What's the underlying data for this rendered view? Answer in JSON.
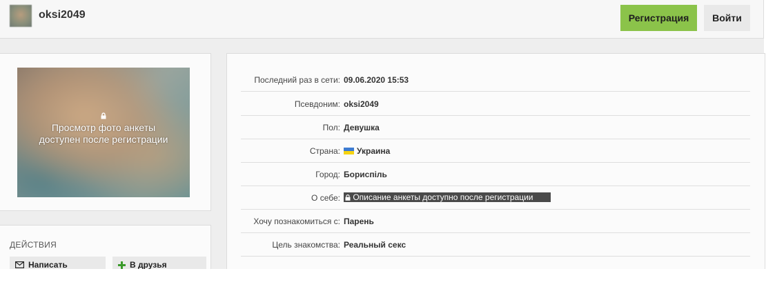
{
  "header": {
    "username": "oksi2049",
    "register_label": "Регистрация",
    "login_label": "Войти"
  },
  "photo": {
    "overlay_line1": "Просмотр фото анкеты",
    "overlay_line2": "доступен после регистрации"
  },
  "actions": {
    "title": "ДЕЙСТВИЯ",
    "write_label": "Написать",
    "friends_label": "В друзья"
  },
  "profile": {
    "rows": [
      {
        "label": "Последний раз в сети:",
        "value": "09.06.2020 15:53"
      },
      {
        "label": "Псевдоним:",
        "value": "oksi2049"
      },
      {
        "label": "Пол:",
        "value": "Девушка"
      },
      {
        "label": "Страна:",
        "value": "Украина"
      },
      {
        "label": "Город:",
        "value": "Бориспіль"
      },
      {
        "label": "О себе:",
        "value": "Описание анкеты доступно после регистрации"
      },
      {
        "label": "Хочу познакомиться с:",
        "value": "Парень"
      },
      {
        "label": "Цель знакомства:",
        "value": "Реальный секс"
      }
    ]
  },
  "colors": {
    "register_bg": "#8bc34a",
    "hidden_desc_bg": "#4a4a4a"
  }
}
